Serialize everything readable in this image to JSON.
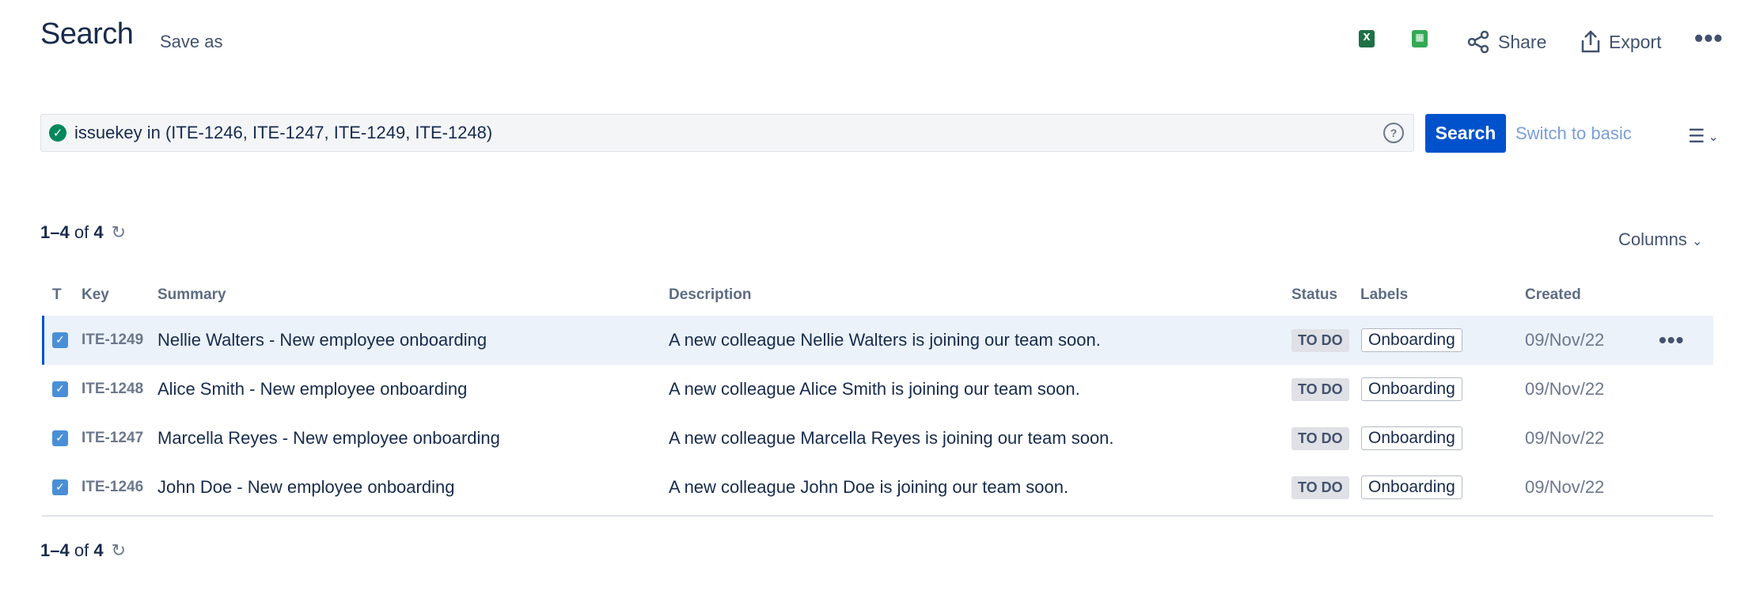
{
  "header": {
    "title": "Search",
    "save_as": "Save as",
    "share": "Share",
    "export": "Export"
  },
  "search": {
    "jql": "issuekey in (ITE-1246, ITE-1247, ITE-1249, ITE-1248)",
    "help": "?",
    "button": "Search",
    "switch": "Switch to basic"
  },
  "results": {
    "range": "1–4",
    "of": "of",
    "total": "4",
    "columns_label": "Columns"
  },
  "table": {
    "headers": {
      "type": "T",
      "key": "Key",
      "summary": "Summary",
      "description": "Description",
      "status": "Status",
      "labels": "Labels",
      "created": "Created"
    },
    "rows": [
      {
        "key": "ITE-1249",
        "summary": "Nellie Walters - New employee onboarding",
        "description": "A new colleague Nellie Walters is joining our team soon.",
        "status": "TO DO",
        "label": "Onboarding",
        "created": "09/Nov/22"
      },
      {
        "key": "ITE-1248",
        "summary": "Alice Smith - New employee onboarding",
        "description": "A new colleague Alice Smith is joining our team soon.",
        "status": "TO DO",
        "label": "Onboarding",
        "created": "09/Nov/22"
      },
      {
        "key": "ITE-1247",
        "summary": "Marcella Reyes - New employee onboarding",
        "description": "A new colleague Marcella Reyes is joining our team soon.",
        "status": "TO DO",
        "label": "Onboarding",
        "created": "09/Nov/22"
      },
      {
        "key": "ITE-1246",
        "summary": "John Doe - New employee onboarding",
        "description": "A new colleague John Doe is joining our team soon.",
        "status": "TO DO",
        "label": "Onboarding",
        "created": "09/Nov/22"
      }
    ]
  },
  "icons": {
    "excel_color": "#1e7145",
    "sheets_color": "#34a853",
    "success_color": "#00875a",
    "primary_color": "#0052cc"
  }
}
